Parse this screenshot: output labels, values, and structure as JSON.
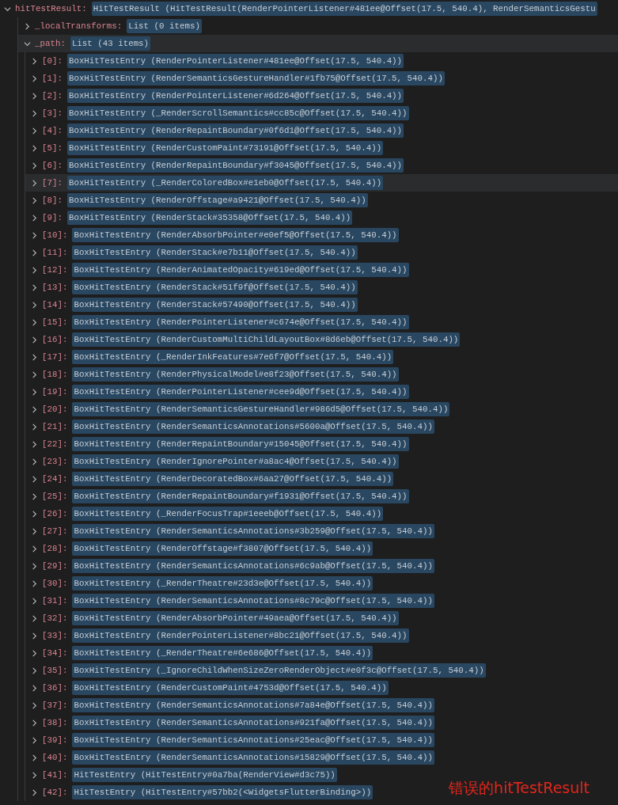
{
  "variables": [
    {
      "name": "hitTestResult:",
      "value": "HitTestResult (HitTestResult(RenderPointerListener#481ee@Offset(17.5, 540.4), RenderSemanticsGestu",
      "expanded": true,
      "hovered": false,
      "children": [
        {
          "name": "_localTransforms:",
          "value": "List (0 items)",
          "expanded": false,
          "hovered": false
        },
        {
          "name": "_path:",
          "value": "List (43 items)",
          "expanded": true,
          "hovered": true,
          "children": [
            {
              "name": "[0]:",
              "value": "BoxHitTestEntry (RenderPointerListener#481ee@Offset(17.5, 540.4))",
              "expanded": false,
              "hovered": false
            },
            {
              "name": "[1]:",
              "value": "BoxHitTestEntry (RenderSemanticsGestureHandler#1fb75@Offset(17.5, 540.4))",
              "expanded": false,
              "hovered": false
            },
            {
              "name": "[2]:",
              "value": "BoxHitTestEntry (RenderPointerListener#6d264@Offset(17.5, 540.4))",
              "expanded": false,
              "hovered": false
            },
            {
              "name": "[3]:",
              "value": "BoxHitTestEntry (_RenderScrollSemantics#cc85c@Offset(17.5, 540.4))",
              "expanded": false,
              "hovered": false
            },
            {
              "name": "[4]:",
              "value": "BoxHitTestEntry (RenderRepaintBoundary#0f6d1@Offset(17.5, 540.4))",
              "expanded": false,
              "hovered": false
            },
            {
              "name": "[5]:",
              "value": "BoxHitTestEntry (RenderCustomPaint#73191@Offset(17.5, 540.4))",
              "expanded": false,
              "hovered": false
            },
            {
              "name": "[6]:",
              "value": "BoxHitTestEntry (RenderRepaintBoundary#f3045@Offset(17.5, 540.4))",
              "expanded": false,
              "hovered": false
            },
            {
              "name": "[7]:",
              "value": "BoxHitTestEntry (_RenderColoredBox#e1eb0@Offset(17.5, 540.4))",
              "expanded": false,
              "hovered": true
            },
            {
              "name": "[8]:",
              "value": "BoxHitTestEntry (RenderOffstage#a9421@Offset(17.5, 540.4))",
              "expanded": false,
              "hovered": false
            },
            {
              "name": "[9]:",
              "value": "BoxHitTestEntry (RenderStack#35358@Offset(17.5, 540.4))",
              "expanded": false,
              "hovered": false
            },
            {
              "name": "[10]:",
              "value": "BoxHitTestEntry (RenderAbsorbPointer#e0ef5@Offset(17.5, 540.4))",
              "expanded": false,
              "hovered": false
            },
            {
              "name": "[11]:",
              "value": "BoxHitTestEntry (RenderStack#e7b11@Offset(17.5, 540.4))",
              "expanded": false,
              "hovered": false
            },
            {
              "name": "[12]:",
              "value": "BoxHitTestEntry (RenderAnimatedOpacity#619ed@Offset(17.5, 540.4))",
              "expanded": false,
              "hovered": false
            },
            {
              "name": "[13]:",
              "value": "BoxHitTestEntry (RenderStack#51f9f@Offset(17.5, 540.4))",
              "expanded": false,
              "hovered": false
            },
            {
              "name": "[14]:",
              "value": "BoxHitTestEntry (RenderStack#57490@Offset(17.5, 540.4))",
              "expanded": false,
              "hovered": false
            },
            {
              "name": "[15]:",
              "value": "BoxHitTestEntry (RenderPointerListener#c674e@Offset(17.5, 540.4))",
              "expanded": false,
              "hovered": false
            },
            {
              "name": "[16]:",
              "value": "BoxHitTestEntry (RenderCustomMultiChildLayoutBox#8d6eb@Offset(17.5, 540.4))",
              "expanded": false,
              "hovered": false
            },
            {
              "name": "[17]:",
              "value": "BoxHitTestEntry (_RenderInkFeatures#7e6f7@Offset(17.5, 540.4))",
              "expanded": false,
              "hovered": false
            },
            {
              "name": "[18]:",
              "value": "BoxHitTestEntry (RenderPhysicalModel#e8f23@Offset(17.5, 540.4))",
              "expanded": false,
              "hovered": false
            },
            {
              "name": "[19]:",
              "value": "BoxHitTestEntry (RenderPointerListener#cee9d@Offset(17.5, 540.4))",
              "expanded": false,
              "hovered": false
            },
            {
              "name": "[20]:",
              "value": "BoxHitTestEntry (RenderSemanticsGestureHandler#986d5@Offset(17.5, 540.4))",
              "expanded": false,
              "hovered": false
            },
            {
              "name": "[21]:",
              "value": "BoxHitTestEntry (RenderSemanticsAnnotations#5600a@Offset(17.5, 540.4))",
              "expanded": false,
              "hovered": false
            },
            {
              "name": "[22]:",
              "value": "BoxHitTestEntry (RenderRepaintBoundary#15045@Offset(17.5, 540.4))",
              "expanded": false,
              "hovered": false
            },
            {
              "name": "[23]:",
              "value": "BoxHitTestEntry (RenderIgnorePointer#a8ac4@Offset(17.5, 540.4))",
              "expanded": false,
              "hovered": false
            },
            {
              "name": "[24]:",
              "value": "BoxHitTestEntry (RenderDecoratedBox#6aa27@Offset(17.5, 540.4))",
              "expanded": false,
              "hovered": false
            },
            {
              "name": "[25]:",
              "value": "BoxHitTestEntry (RenderRepaintBoundary#f1931@Offset(17.5, 540.4))",
              "expanded": false,
              "hovered": false
            },
            {
              "name": "[26]:",
              "value": "BoxHitTestEntry (_RenderFocusTrap#1eeeb@Offset(17.5, 540.4))",
              "expanded": false,
              "hovered": false
            },
            {
              "name": "[27]:",
              "value": "BoxHitTestEntry (RenderSemanticsAnnotations#3b259@Offset(17.5, 540.4))",
              "expanded": false,
              "hovered": false
            },
            {
              "name": "[28]:",
              "value": "BoxHitTestEntry (RenderOffstage#f3807@Offset(17.5, 540.4))",
              "expanded": false,
              "hovered": false
            },
            {
              "name": "[29]:",
              "value": "BoxHitTestEntry (RenderSemanticsAnnotations#6c9ab@Offset(17.5, 540.4))",
              "expanded": false,
              "hovered": false
            },
            {
              "name": "[30]:",
              "value": "BoxHitTestEntry (_RenderTheatre#23d3e@Offset(17.5, 540.4))",
              "expanded": false,
              "hovered": false
            },
            {
              "name": "[31]:",
              "value": "BoxHitTestEntry (RenderSemanticsAnnotations#8c79c@Offset(17.5, 540.4))",
              "expanded": false,
              "hovered": false
            },
            {
              "name": "[32]:",
              "value": "BoxHitTestEntry (RenderAbsorbPointer#49aea@Offset(17.5, 540.4))",
              "expanded": false,
              "hovered": false
            },
            {
              "name": "[33]:",
              "value": "BoxHitTestEntry (RenderPointerListener#8bc21@Offset(17.5, 540.4))",
              "expanded": false,
              "hovered": false
            },
            {
              "name": "[34]:",
              "value": "BoxHitTestEntry (_RenderTheatre#6e686@Offset(17.5, 540.4))",
              "expanded": false,
              "hovered": false
            },
            {
              "name": "[35]:",
              "value": "BoxHitTestEntry (_IgnoreChildWhenSizeZeroRenderObject#e0f3c@Offset(17.5, 540.4))",
              "expanded": false,
              "hovered": false
            },
            {
              "name": "[36]:",
              "value": "BoxHitTestEntry (RenderCustomPaint#4753d@Offset(17.5, 540.4))",
              "expanded": false,
              "hovered": false
            },
            {
              "name": "[37]:",
              "value": "BoxHitTestEntry (RenderSemanticsAnnotations#7a84e@Offset(17.5, 540.4))",
              "expanded": false,
              "hovered": false
            },
            {
              "name": "[38]:",
              "value": "BoxHitTestEntry (RenderSemanticsAnnotations#921fa@Offset(17.5, 540.4))",
              "expanded": false,
              "hovered": false
            },
            {
              "name": "[39]:",
              "value": "BoxHitTestEntry (RenderSemanticsAnnotations#25eac@Offset(17.5, 540.4))",
              "expanded": false,
              "hovered": false
            },
            {
              "name": "[40]:",
              "value": "BoxHitTestEntry (RenderSemanticsAnnotations#15829@Offset(17.5, 540.4))",
              "expanded": false,
              "hovered": false
            },
            {
              "name": "[41]:",
              "value": "HitTestEntry (HitTestEntry#0a7ba(RenderView#d3c75))",
              "expanded": false,
              "hovered": false
            },
            {
              "name": "[42]:",
              "value": "HitTestEntry (HitTestEntry#57bb2(<WidgetsFlutterBinding>))",
              "expanded": false,
              "hovered": false
            }
          ]
        }
      ]
    }
  ],
  "annotation": "错误的hitTestResult"
}
